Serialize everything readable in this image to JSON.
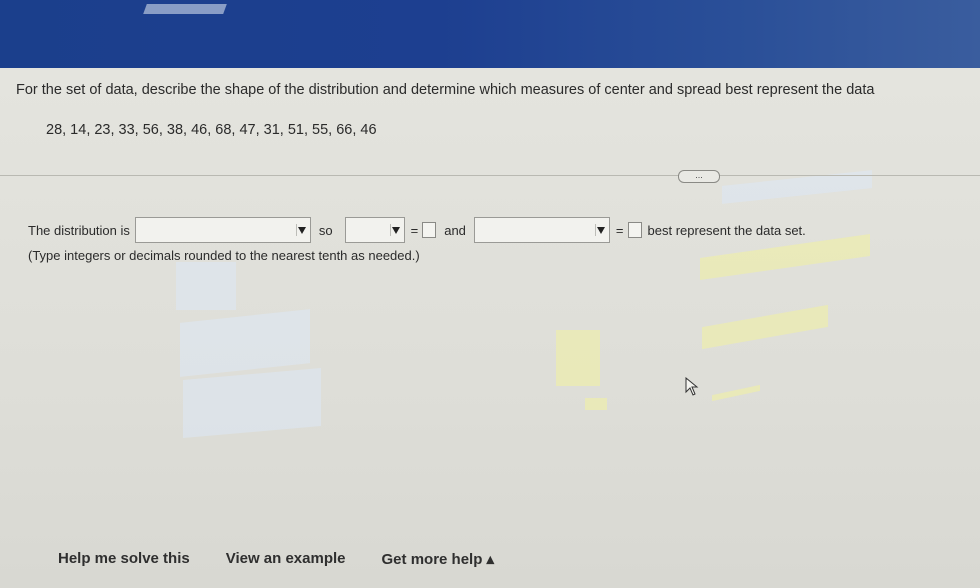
{
  "question": {
    "prompt": "For the set of data, describe the shape of the distribution and determine which measures of center and spread best represent the data",
    "data_values": "28, 14, 23, 33, 56, 38, 46, 68, 47, 31, 51, 55, 66, 46"
  },
  "expand_button": {
    "label": "..."
  },
  "answer": {
    "lead": "The distribution is",
    "so": "so",
    "eq1": "=",
    "and": "and",
    "eq2": "=",
    "tail": "best represent the data set.",
    "hint": "(Type integers or decimals rounded to the nearest tenth as needed.)"
  },
  "help": {
    "solve": "Help me solve this",
    "example": "View an example",
    "more": "Get more help ▴"
  }
}
